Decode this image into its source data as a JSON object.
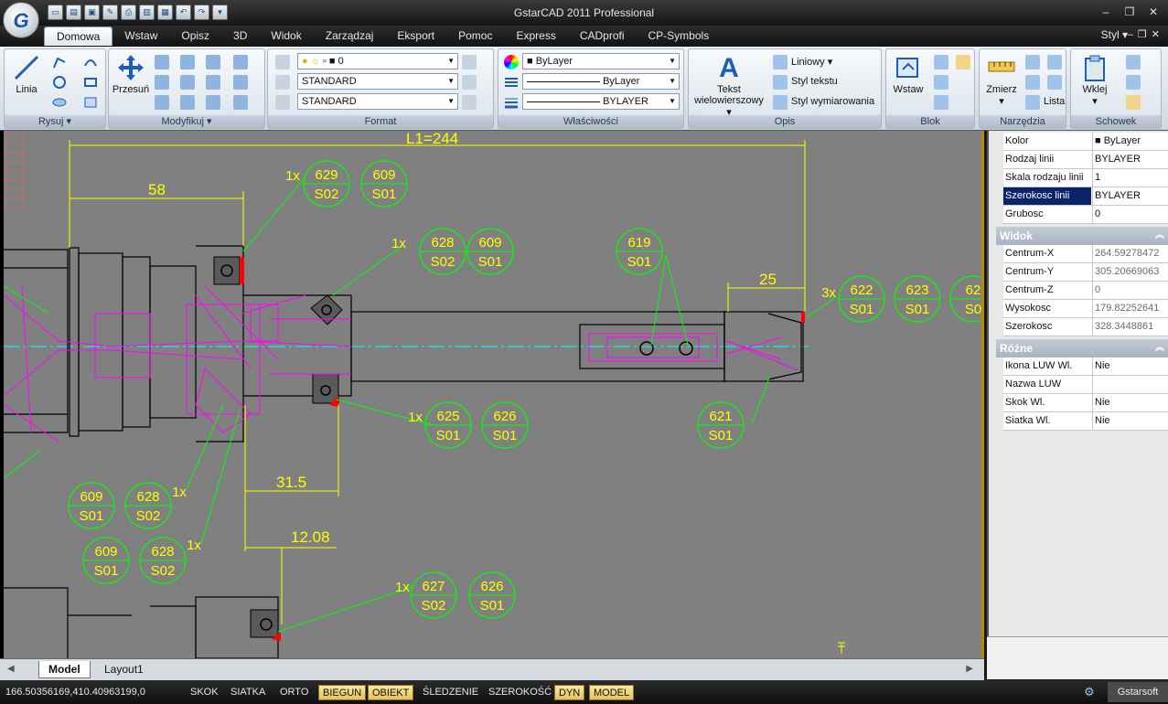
{
  "window": {
    "title": "GstarCAD 2011 Professional"
  },
  "tabs": [
    "Domowa",
    "Wstaw",
    "Opisz",
    "3D",
    "Widok",
    "Zarządzaj",
    "Eksport",
    "Pomoc",
    "Express",
    "CADprofi",
    "CP-Symbols"
  ],
  "style_menu": "Styl",
  "ribbon": {
    "rysuj": {
      "title": "Rysuj",
      "linia": "Linia"
    },
    "modyfikuj": {
      "title": "Modyfikuj",
      "przesun": "Przesuń"
    },
    "format": {
      "title": "Format",
      "layer": "0",
      "text_style": "STANDARD",
      "dim_style": "STANDARD"
    },
    "wlasciwosci": {
      "title": "Właściwości",
      "color": "ByLayer",
      "linetype": "ByLayer",
      "lineweight": "BYLAYER"
    },
    "opis": {
      "title": "Opis",
      "tekst": "Tekst",
      "tekst2": "wielowierszowy",
      "liniowy": "Liniowy",
      "styl_tekstu": "Styl tekstu",
      "styl_wym": "Styl wymiarowania"
    },
    "blok": {
      "title": "Blok",
      "wstaw": "Wstaw"
    },
    "narzedzia": {
      "title": "Narzędzia",
      "zmierz": "Zmierz",
      "lista": "Lista"
    },
    "schowek": {
      "title": "Schowek",
      "wklej": "Wklej"
    }
  },
  "drawing": {
    "dims": {
      "l1": "L1=244",
      "d58": "58",
      "d25": "25",
      "d315": "31.5",
      "d1208": "12.08"
    },
    "balloons": {
      "b1": {
        "mult": "1x",
        "a1": "629",
        "a2": "S02",
        "b1": "609",
        "b2": "S01"
      },
      "b2": {
        "mult": "1x",
        "a1": "628",
        "a2": "S02",
        "b1": "609",
        "b2": "S01"
      },
      "b3": {
        "a1": "619",
        "a2": "S01"
      },
      "b4": {
        "mult": "3x",
        "a1": "622",
        "a2": "S01",
        "b1": "623",
        "b2": "S01",
        "c1": "62",
        "c2": "S0"
      },
      "b5": {
        "mult": "1x",
        "a1": "625",
        "a2": "S01",
        "b1": "626",
        "b2": "S01"
      },
      "b6": {
        "a1": "621",
        "a2": "S01"
      },
      "b7": {
        "mult": "1x",
        "a1": "609",
        "a2": "S01",
        "b1": "628",
        "b2": "S02"
      },
      "b8": {
        "mult": "1x",
        "a1": "609",
        "a2": "S01",
        "b1": "628",
        "b2": "S02"
      },
      "b9": {
        "mult": "1x",
        "a1": "627",
        "a2": "S02",
        "b1": "626",
        "b2": "S01"
      }
    },
    "colors": {
      "bg": "#808080",
      "geometry": "#000000",
      "annotation": "#00ff00",
      "dimension": "#ffff00",
      "hidden": "#ff00ff",
      "center": "#00ffff"
    }
  },
  "layout_tabs": [
    "Model",
    "Layout1"
  ],
  "properties": {
    "general": [
      {
        "k": "Kolor",
        "v": "ByLayer"
      },
      {
        "k": "Rodzaj linii",
        "v": "BYLAYER"
      },
      {
        "k": "Skala rodzaju linii",
        "v": "1"
      },
      {
        "k": "Szerokosc linii",
        "v": "BYLAYER"
      },
      {
        "k": "Grubosc",
        "v": "0"
      }
    ],
    "widok_title": "Widok",
    "widok": [
      {
        "k": "Centrum-X",
        "v": "264.59278472"
      },
      {
        "k": "Centrum-Y",
        "v": "305.20669063"
      },
      {
        "k": "Centrum-Z",
        "v": "0"
      },
      {
        "k": "Wysokosc",
        "v": "179.82252641"
      },
      {
        "k": "Szerokosc",
        "v": "328.3448861"
      }
    ],
    "rozne_title": "Różne",
    "rozne": [
      {
        "k": "Ikona LUW Wl.",
        "v": "Nie"
      },
      {
        "k": "Nazwa LUW",
        "v": ""
      },
      {
        "k": "Skok Wl.",
        "v": "Nie"
      },
      {
        "k": "Siatka Wl.",
        "v": "Nie"
      }
    ]
  },
  "status": {
    "coords": "166.50356169,410.40963199,0",
    "buttons": [
      {
        "label": "SKOK",
        "on": false
      },
      {
        "label": "SIATKA",
        "on": false
      },
      {
        "label": "ORTO",
        "on": false
      },
      {
        "label": "BIEGUN",
        "on": true
      },
      {
        "label": "OBIEKT",
        "on": true
      },
      {
        "label": "ŚLEDZENIE",
        "on": false
      },
      {
        "label": "SZEROKOŚĆ",
        "on": false
      },
      {
        "label": "DYN",
        "on": true
      },
      {
        "label": "MODEL",
        "on": true
      }
    ],
    "brand": "Gstarsoft"
  }
}
